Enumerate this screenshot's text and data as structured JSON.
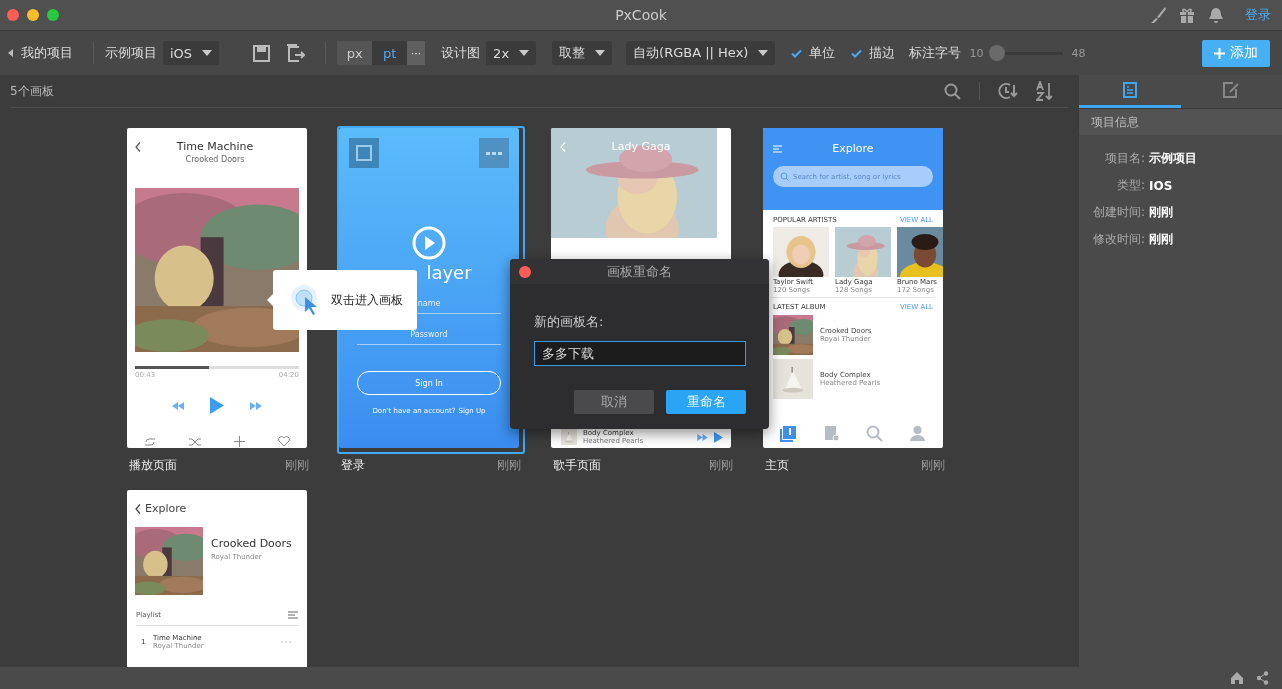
{
  "window": {
    "title": "PxCook",
    "login": "登录"
  },
  "toolbar": {
    "back": "我的项目",
    "project": "示例项目",
    "platform": "iOS",
    "units": [
      {
        "label": "px",
        "selected": false
      },
      {
        "label": "pt",
        "selected": true
      }
    ],
    "more": "···",
    "design_label": "设计图",
    "scale": "2x",
    "rounding": "取整",
    "color_format": "自动(RGBA || Hex)",
    "checks": [
      {
        "label": "单位",
        "checked": true
      },
      {
        "label": "描边",
        "checked": true
      }
    ],
    "font_label": "标注字号",
    "font_slider": {
      "min": "10",
      "max": "48",
      "level": 0
    },
    "add": "添加"
  },
  "canvas": {
    "count": "5个画板",
    "artboards": [
      {
        "kind": "player",
        "name": "播放页面",
        "time": "刚刚",
        "selected": false,
        "title": "Time Machine",
        "artist": "Crooked Doors",
        "elapsed": "00:43",
        "total": "04:20",
        "level": 0.45
      },
      {
        "kind": "login",
        "name": "登录",
        "time": "刚刚",
        "selected": true,
        "title": "layer",
        "user": "name",
        "password": "Password",
        "button": "Sign In",
        "prompt": "Don't have an account?",
        "link": "Sign Up"
      },
      {
        "kind": "singer",
        "name": "歌手页面",
        "time": "刚刚",
        "selected": false,
        "title": "Lady Gaga",
        "song": "Body Complex",
        "artist": "Heathered Pearls"
      },
      {
        "kind": "home",
        "name": "主页",
        "time": "刚刚",
        "selected": false,
        "title": "Explore",
        "placeholder": "Search for artist, song or lyrics",
        "section_1": "POPULAR ARTISTS",
        "view_all_1": "VIEW ALL",
        "section_2": "LATEST ALBUM",
        "view_all_2": "VIEW ALL",
        "artists": [
          {
            "name": "Taylor Swift",
            "songs": "120 Songs"
          },
          {
            "name": "Lady Gaga",
            "songs": "128 Songs"
          },
          {
            "name": "Bruno Mars",
            "songs": "172 Songs"
          }
        ],
        "albums": [
          {
            "title": "Crooked Doors",
            "artist": "Royal Thunder"
          },
          {
            "title": "Body Complex",
            "artist": "Heathered Pearls"
          }
        ],
        "tabs": [
          {
            "selected": true
          },
          {
            "selected": false
          },
          {
            "selected": false
          },
          {
            "selected": false
          }
        ]
      },
      {
        "kind": "album",
        "back": "Explore",
        "title": "Crooked Doors",
        "artist": "Royal Thunder",
        "playlist": "Playlist",
        "track_number": "1",
        "track": "Time Machine",
        "track_artist": "Royal Thunder"
      }
    ]
  },
  "tooltip": {
    "text": "双击进入画板"
  },
  "dialog": {
    "title": "画板重命名",
    "label": "新的画板名:",
    "value": "多多下载",
    "cancel": "取消",
    "confirm": "重命名"
  },
  "panel": {
    "tabs": [
      {
        "selected": true
      },
      {
        "selected": false
      }
    ],
    "section": "项目信息",
    "fields": [
      {
        "label": "项目名:",
        "value": "示例项目"
      },
      {
        "label": "类型:",
        "value": "IOS"
      },
      {
        "label": "创建时间:",
        "value": "刚刚"
      },
      {
        "label": "修改时间:",
        "value": "刚刚"
      }
    ]
  }
}
